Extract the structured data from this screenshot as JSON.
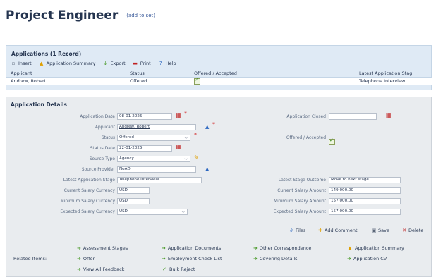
{
  "page": {
    "title": "Project Engineer",
    "add_to_set": "(add to set)"
  },
  "applications": {
    "heading": "Applications (1 Record)",
    "toolbar": {
      "insert": "Insert",
      "summary": "Application Summary",
      "export": "Export",
      "print": "Print",
      "help": "Help"
    },
    "columns": [
      "Applicant",
      "Status",
      "Offered / Accepted",
      "Latest Application Stag"
    ],
    "rows": [
      {
        "applicant": "Andrew, Robert",
        "status": "Offered",
        "offered_accepted": true,
        "latest_stage": "Telephone Interview"
      }
    ]
  },
  "details": {
    "heading": "Application Details",
    "labels": {
      "application_date": "Application Date",
      "applicant": "Applicant",
      "status": "Status",
      "status_date": "Status Date",
      "source_type": "Source Type",
      "source_provider": "Source Provider",
      "latest_stage": "Latest Application Stage",
      "current_currency": "Current Salary Currency",
      "minimum_currency": "Minimum Salary Currency",
      "expected_currency": "Expected Salary Currency",
      "application_closed": "Application Closed",
      "offered_accepted": "Offered / Accepted",
      "latest_outcome": "Latest Stage Outcome",
      "current_amount": "Current Salary Amount",
      "minimum_amount": "Minimum Salary Amount",
      "expected_amount": "Expected Salary Amount"
    },
    "values": {
      "application_date": "08-01-2025",
      "applicant": "Andrew, Robert",
      "status": "Offered",
      "status_date": "22-01-2025",
      "source_type": "Agency",
      "source_provider": "NoAD",
      "latest_stage": "Telephone Interview",
      "current_currency": "USD",
      "minimum_currency": "USD",
      "expected_currency": "USD",
      "application_closed": "",
      "offered_accepted": true,
      "latest_outcome": "Move to next stage",
      "current_amount": "149,000.00",
      "minimum_amount": "157,000.00",
      "expected_amount": "157,000.00"
    },
    "actions": {
      "files": "Files",
      "add_comment": "Add Comment",
      "save": "Save",
      "delete": "Delete"
    },
    "related": {
      "label": "Related Items:",
      "items": [
        "Assessment Stages",
        "Application Documents",
        "Other Correspondence",
        "Application Summary",
        "Offer",
        "Employment Check List",
        "Covering Details",
        "Application CV",
        "View All Feedback",
        "Bulk Reject"
      ]
    }
  },
  "colors": {
    "panel_blue": "#dfeaf5",
    "panel_gray": "#e9ecef",
    "accent_green": "#4a9a2a",
    "required_red": "#d02020"
  }
}
